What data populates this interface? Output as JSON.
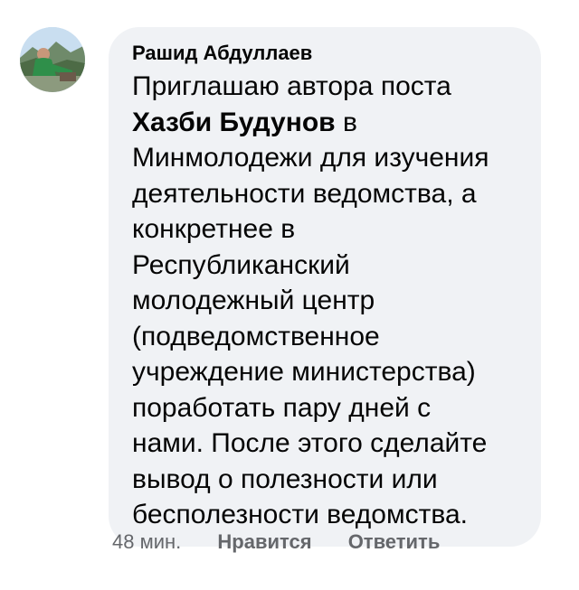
{
  "comment": {
    "author": "Рашид Абдуллаев",
    "avatar_icon": "profile-photo-avatar",
    "text_before_mention": "Приглашаю автора поста\n",
    "mention": "Хазби Будунов",
    "text_after_mention": " в\nМинмолодежи для изучения\nдеятельности ведомства, а\nконкретнее в\nРеспубликанский\nмолодежный центр\n(подведомственное\nучреждение министерства)\nпоработать пару дней с\nнами. После этого сделайте\nвывод о полезности или\nбесполезности ведомства.",
    "bubble_color": "#f0f2f5",
    "text_color": "#050505"
  },
  "actions": {
    "time": "48 мин.",
    "like_label": "Нравится",
    "reply_label": "Ответить",
    "color": "#65676b"
  }
}
